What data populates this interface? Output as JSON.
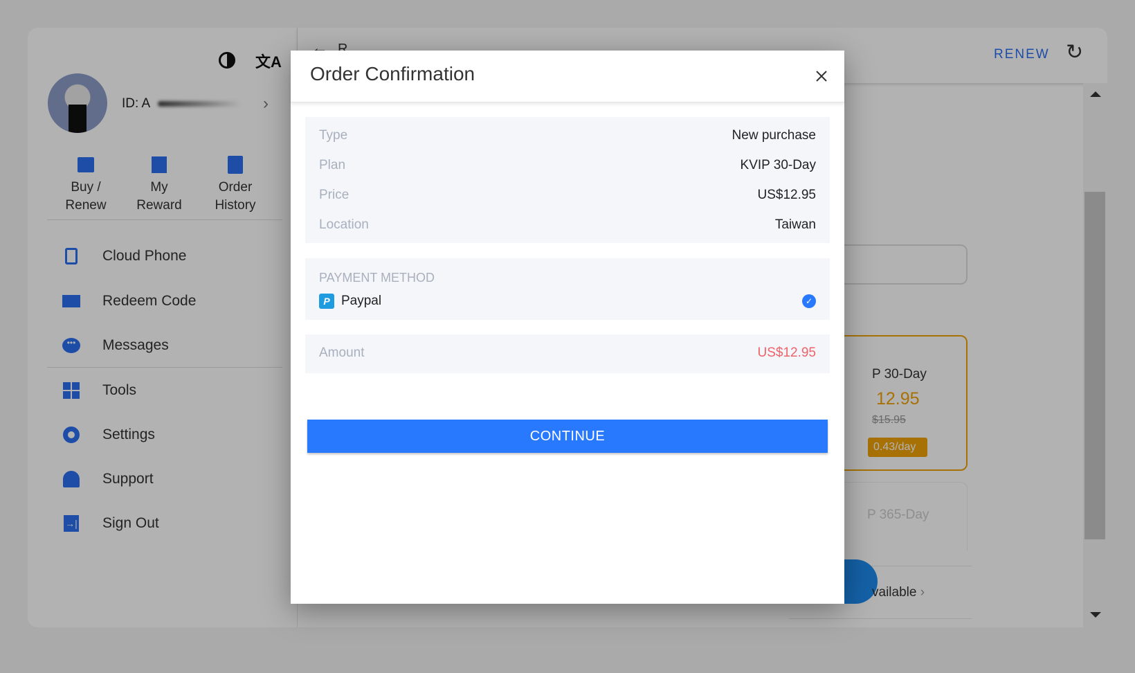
{
  "sidebar": {
    "user_id": "ID: A",
    "quick_actions": [
      {
        "line1": "Buy /",
        "line2": "Renew",
        "icon": "shopping-bag-icon"
      },
      {
        "line1": "My",
        "line2": "Reward",
        "icon": "gift-icon"
      },
      {
        "line1": "Order",
        "line2": "History",
        "icon": "clipboard-icon"
      }
    ],
    "menu": [
      {
        "label": "Cloud Phone",
        "icon": "cloud-phone-icon"
      },
      {
        "label": "Redeem Code",
        "icon": "ticket-icon"
      },
      {
        "label": "Messages",
        "icon": "chat-bubble-icon"
      },
      {
        "label": "Tools",
        "icon": "tools-grid-icon"
      },
      {
        "label": "Settings",
        "icon": "gear-icon"
      },
      {
        "label": "Support",
        "icon": "support-agent-icon"
      },
      {
        "label": "Sign Out",
        "icon": "sign-out-icon"
      }
    ]
  },
  "header": {
    "back_title": "R",
    "renew_label": "RENEW"
  },
  "background_plans": {
    "plan1_name": "P 30-Day",
    "plan1_price": "12.95",
    "plan1_old_price": "$15.95",
    "plan1_per_day": "0.43/day",
    "plan2_name": "P 365-Day",
    "coupon_text": "vailable"
  },
  "modal": {
    "title": "Order Confirmation",
    "details": [
      {
        "label": "Type",
        "value": "New purchase"
      },
      {
        "label": "Plan",
        "value": "KVIP 30-Day"
      },
      {
        "label": "Price",
        "value": "US$12.95"
      },
      {
        "label": "Location",
        "value": "Taiwan"
      }
    ],
    "payment_label": "PAYMENT METHOD",
    "payment_method": "Paypal",
    "amount_label": "Amount",
    "amount_value": "US$12.95",
    "continue_label": "CONTINUE"
  },
  "colors": {
    "accent": "#2979ff",
    "amount": "#f0626a",
    "plan_highlight": "#f0a30a"
  }
}
